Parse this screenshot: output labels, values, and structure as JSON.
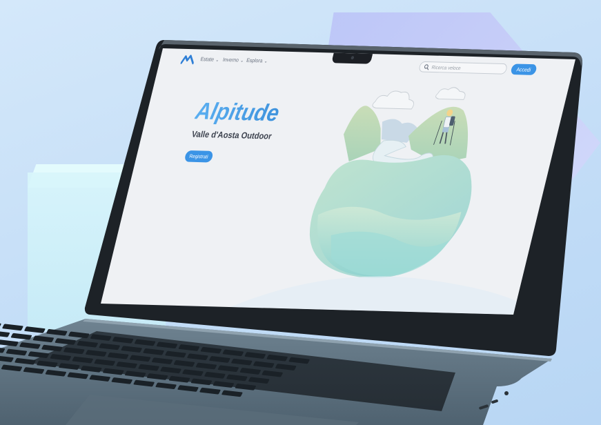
{
  "nav": {
    "items": [
      {
        "label": "Estate"
      },
      {
        "label": "Inverno"
      },
      {
        "label": "Esplora"
      }
    ],
    "search_placeholder": "Ricerca veloce",
    "login_label": "Accedi"
  },
  "hero": {
    "title": "Alpitude",
    "subtitle": "Valle d'Aosta Outdoor",
    "register_label": "Registrati"
  },
  "icons": {
    "logo": "alpitude-logo-icon",
    "search": "search-icon",
    "caret": "chevron-down-icon"
  },
  "colors": {
    "accent": "#3b94e6",
    "title": "#4aa3e8",
    "screen_bg": "#eff1f4"
  }
}
